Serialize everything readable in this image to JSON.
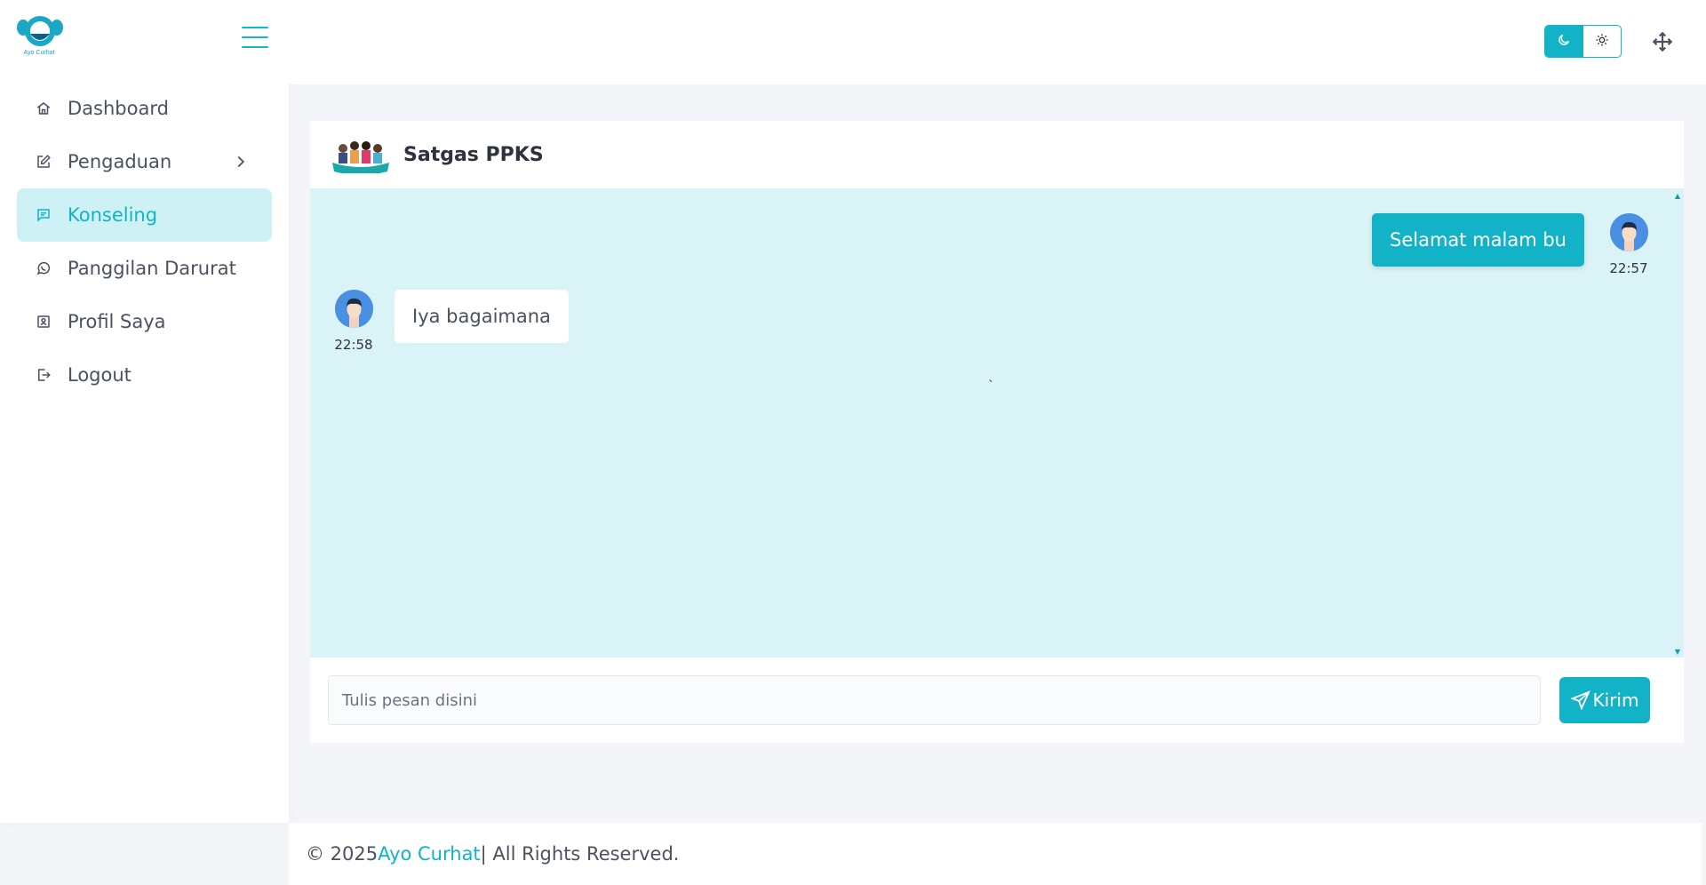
{
  "app": {
    "logo_text": "Ayo Curhat"
  },
  "sidebar": {
    "items": [
      {
        "label": "Dashboard",
        "icon": "home-icon"
      },
      {
        "label": "Pengaduan",
        "icon": "edit-icon"
      },
      {
        "label": "Konseling",
        "icon": "message-icon"
      },
      {
        "label": "Panggilan Darurat",
        "icon": "whatsapp-icon"
      },
      {
        "label": "Profil Saya",
        "icon": "profile-icon"
      },
      {
        "label": "Logout",
        "icon": "logout-icon"
      }
    ]
  },
  "chat": {
    "title": "Satgas PPKS",
    "messages": [
      {
        "direction": "outgoing",
        "text": "Selamat malam bu",
        "time": "22:57"
      },
      {
        "direction": "incoming",
        "text": "Iya bagaimana",
        "time": "22:58"
      }
    ],
    "stray_mark": "`",
    "input_placeholder": "Tulis pesan disini",
    "send_label": "Kirim"
  },
  "footer": {
    "prefix": "© 2025",
    "brand": "Ayo Curhat",
    "suffix": "| All Rights Reserved."
  },
  "colors": {
    "accent": "#12b3c7",
    "chat_bg": "#daf3f6",
    "active_nav_bg": "#cdf1f5"
  }
}
